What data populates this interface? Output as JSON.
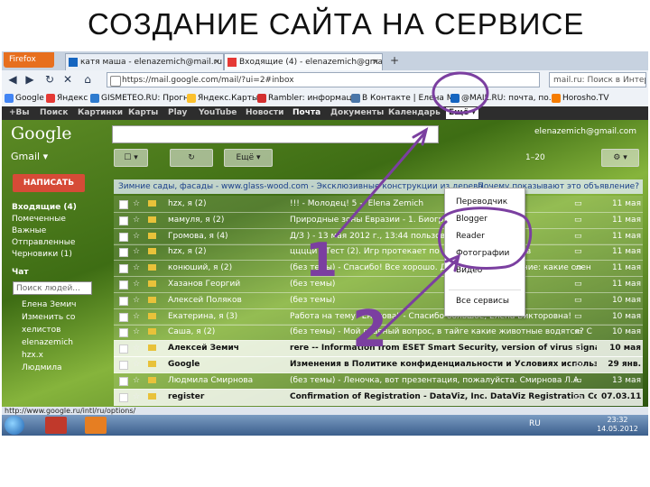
{
  "slide": {
    "title": "СОЗДАНИЕ САЙТА НА  СЕРВИСЕ"
  },
  "browser": {
    "firefox_button": "Firefox",
    "tabs": [
      {
        "label": "катя маша - elenazemich@mail.ru - ."
      },
      {
        "label": "Входящие (4) - elenazemich@gmail ."
      }
    ],
    "new_tab": "+",
    "url": "https://mail.google.com/mail/?ui=2#inbox",
    "search_placeholder": "mail.ru: Поиск в Интернете",
    "bookmarks": [
      {
        "label": "Google",
        "color": "#4285f4"
      },
      {
        "label": "Яндекс",
        "color": "#e53935"
      },
      {
        "label": "GISMETEO.RU: Прогн.",
        "color": "#2e7bcf"
      },
      {
        "label": "Яндекс.Карты",
        "color": "#fbc02d"
      },
      {
        "label": "Rambler: информаци.",
        "color": "#d32f2f"
      },
      {
        "label": "В Контакте | Елена М.",
        "color": "#4a76a8"
      },
      {
        "label": "@MAIL.RU: почта, по.",
        "color": "#1565c0"
      },
      {
        "label": "Horosho.TV",
        "color": "#f57c00"
      }
    ]
  },
  "google_bar": {
    "items": [
      "+Вы",
      "Поиск",
      "Картинки",
      "Карты",
      "Play",
      "YouTube",
      "Новости",
      "Почта",
      "Документы",
      "Календарь"
    ],
    "selected": "Почта",
    "more": "Ещё ▾"
  },
  "gmail": {
    "logo": "Google",
    "user_email": "elenazemich@gmail.com",
    "label": "Gmail ▾",
    "tool_more": "Ещё ▾",
    "page_info": "1–20",
    "compose": "НАПИСАТЬ",
    "sidebar": [
      "Входящие (4)",
      "Помеченные",
      "Важные",
      "Отправленные",
      "Черновики (1)"
    ],
    "chat_label": "Чат",
    "chat_search": "Поиск людей...",
    "contacts": [
      "Елена Земич",
      "Изменить со",
      "хелистов",
      "elenazemich",
      "hzx.x",
      "Людмила"
    ],
    "ad_text": "Зимние сады, фасады - www.glass-wood.com - Эксклюзивные конструкции из дерева",
    "ad_right": "Почему показывают это объявление?",
    "messages": [
      {
        "sender": "hzx, я (2)",
        "subject": "!!! - Молодец! 5 -- Elena Zemich",
        "date": "11 мая",
        "unread": false
      },
      {
        "sender": "мамуля, я (2)",
        "subject": "Природные зоны Евразии - 1. Биография, широко",
        "date": "11 мая",
        "unread": false
      },
      {
        "sender": "Громова, я (4)",
        "subject": "Д/З ) - 13 мая 2012 г., 13:44 пользователь ...",
        "date": "11 мая",
        "unread": false
      },
      {
        "sender": "hzx, я (2)",
        "subject": "ццццй - Тест (2). Игр протекает по ... нескольких шагов",
        "date": "11 мая",
        "unread": false
      },
      {
        "sender": "конюший, я (2)",
        "subject": "(без темы) - Спасибо! Все хорошо. Достаточно уточнение: какие слен",
        "date": "11 мая",
        "unread": false
      },
      {
        "sender": "Хазанов Георгий",
        "subject": "(без темы)",
        "date": "11 мая",
        "unread": false
      },
      {
        "sender": "Алексей Поляков",
        "subject": "(без темы)",
        "date": "10 мая",
        "unread": false
      },
      {
        "sender": "Екатерина, я (3)",
        "subject": "Работа на тему \"Енотова\" - Спасибо большое, Елена Викторовна!",
        "date": "10 мая",
        "unread": false
      },
      {
        "sender": "Саша, я (2)",
        "subject": "(без темы) - Мой главный вопрос, в тайге какие животные водятся? С",
        "date": "10 мая",
        "unread": false
      },
      {
        "sender": "Алексей Земич",
        "subject": "rere -- Information from ESET Smart Security, version of virus signature dat",
        "date": "10 мая",
        "unread": true
      },
      {
        "sender": "Google",
        "subject": "Изменения в Политике конфиденциальности и Условиях использования",
        "date": "29 янв.",
        "unread": true
      },
      {
        "sender": "Людмила Смирнова",
        "subject": "(без темы) - Леночка, вот презентация, пожалуйста. Смирнова Л.А.",
        "date": "13 мая",
        "unread": false
      },
      {
        "sender": "register",
        "subject": "Confirmation of Registration - DataViz, Inc. DataViz Registration Confirm",
        "date": "07.03.11",
        "unread": true
      }
    ],
    "dropdown": [
      "Переводчик",
      "Blogger",
      "Reader",
      "Фотографии",
      "Видео",
      "Все сервисы"
    ]
  },
  "status_url": "http://www.google.ru/intl/ru/options/",
  "taskbar": {
    "lang": "RU",
    "time": "23:32",
    "date": "14.05.2012"
  },
  "annotations": {
    "step1": "1",
    "step2": "2",
    "color": "#7b3fa0"
  }
}
